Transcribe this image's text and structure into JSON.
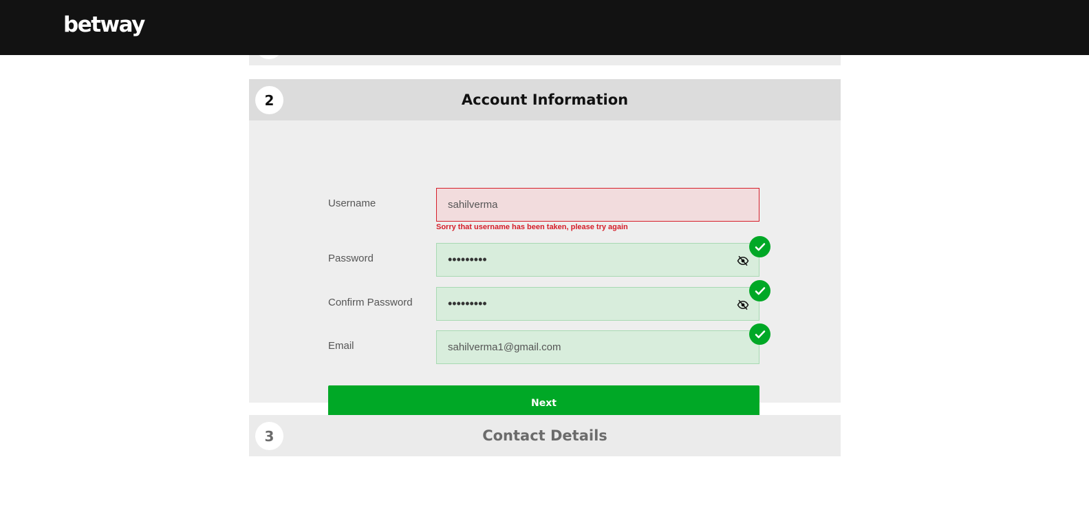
{
  "brand": {
    "logo_text": "betway"
  },
  "step2": {
    "number": "2",
    "title": "Account Information",
    "username": {
      "label": "Username",
      "value": "sahilverma",
      "error": "Sorry that username has been taken, please try again"
    },
    "password": {
      "label": "Password",
      "value": "•••••••••"
    },
    "confirm_password": {
      "label": "Confirm Password",
      "value": "•••••••••"
    },
    "email": {
      "label": "Email",
      "value": "sahilverma1@gmail.com"
    },
    "next_label": "Next"
  },
  "step3": {
    "number": "3",
    "title": "Contact Details"
  },
  "colors": {
    "accent_green": "#00a826",
    "error_red": "#d51d28",
    "header_dark": "#121212"
  },
  "icons": {
    "password_toggle": "eye-slash-icon",
    "valid": "check-circle-icon"
  }
}
